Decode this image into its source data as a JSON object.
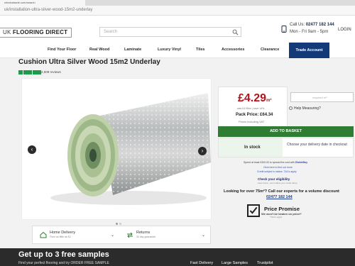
{
  "browser": {
    "tab_title": "checkatrade.com/search",
    "url": "uk/installation-ultra-silver-wood-15m2-underlay"
  },
  "header": {
    "logo_prefix": "UK",
    "logo_text": "FLOORING DIRECT",
    "search_placeholder": "Search",
    "call_label": "Call Us:",
    "call_number": "02477 182 144",
    "call_hours": "Mon - Fri 9am - 5pm",
    "login": "LOGIN"
  },
  "nav": {
    "items": [
      "Find Your Floor",
      "Real Wood",
      "Laminate",
      "Luxury Vinyl",
      "Tiles",
      "Accessories",
      "Clearance"
    ],
    "trade": "Trade Account"
  },
  "product": {
    "title": "Cushion Ultra Silver Wood 15m2 Underlay",
    "rating_stars": 5,
    "reviews": "2,509 reviews",
    "price": "£4.29",
    "price_unit": "m²",
    "was_price": "was £4.95m² | save 14%",
    "pack_price": "Pack Price: £64.34",
    "inc_vat": "Prices including VAT",
    "qty_placeholder": "required m²",
    "help_measuring": "Help Measuring?",
    "add_to_basket": "ADD TO BASKET",
    "stock": "In stock",
    "delivery_note": "Choose your delivery date in checkout",
    "divide_buy_text": "Spend at least £300.00 to spread the cost with",
    "divide_buy_brand": "DivideBuy",
    "link_find_out": "Click here to find out more",
    "link_status": "Credit subject to status. T&Cs apply",
    "eligibility": "Check your eligibility",
    "eligibility_sub": "Fast check - won't affect your credit rating",
    "volume": "Looking for over 75m²? Call our experts for a volume discount",
    "volume_phone": "02477 182 144",
    "promise_title": "Price Promise",
    "promise_sub": "We won't be beaten on price!*",
    "promise_tc": "*T&C's apply"
  },
  "info": {
    "delivery_title": "Home Delivery",
    "delivery_sub": "From as little as £0",
    "returns_title": "Returns",
    "returns_sub": "30 day guarantee"
  },
  "banner": {
    "title": "Get up to 3 free samples",
    "sub": "Find your perfect flooring and try ORDER FREE SAMPLE",
    "links": [
      "Fast Delivery",
      "Large Samples",
      "Trustpilot"
    ]
  }
}
